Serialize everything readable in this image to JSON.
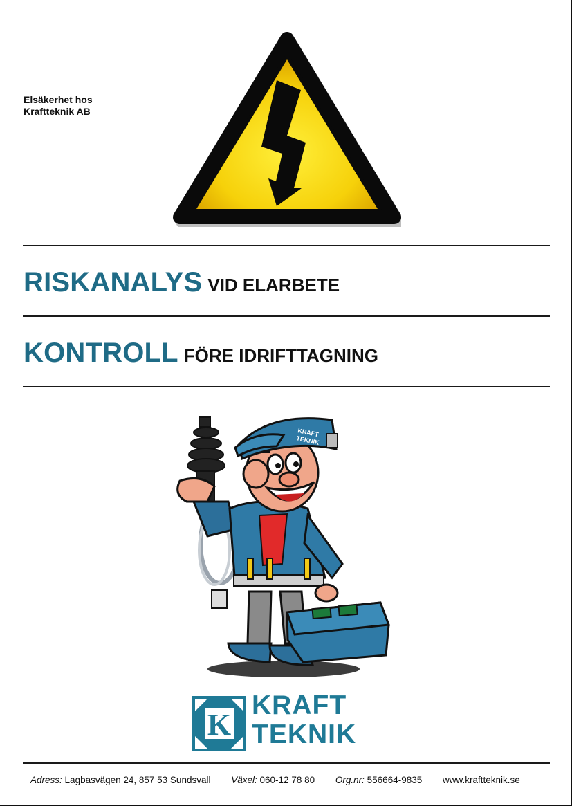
{
  "header": {
    "intro_line1": "Elsäkerhet hos",
    "intro_line2": "Kraftteknik AB"
  },
  "icons": {
    "warning": "high-voltage-warning-icon",
    "mascot": "electrician-mascot-illustration",
    "logo": "kraftteknik-logo"
  },
  "titles": {
    "title1_big": "RISKANALYS",
    "title1_small": "VID ELARBETE",
    "title2_big": "KONTROLL",
    "title2_small": "FÖRE IDRIFTTAGNING"
  },
  "logo": {
    "line1": "KRAFT",
    "line2": "TEKNIK",
    "cap_line1": "KRAFT",
    "cap_line2": "TEKNIK"
  },
  "footer": {
    "address_label": "Adress:",
    "address_value": "Lagbasvägen 24, 857 53 Sundsvall",
    "phone_label": "Växel:",
    "phone_value": "060-12 78 80",
    "org_label": "Org.nr:",
    "org_value": "556664-9835",
    "website": "www.kraftteknik.se"
  },
  "colors": {
    "brand_blue": "#1f6b86",
    "warning_yellow": "#f6d10a",
    "text_dark": "#111111"
  }
}
